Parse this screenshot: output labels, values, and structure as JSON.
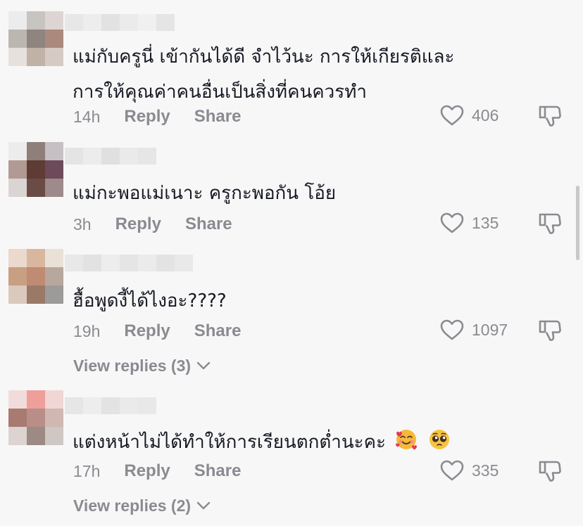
{
  "comments": [
    {
      "text_lines": [
        "แม่กับครูนี่ เข้ากันได้ดี จำไว้นะ การให้เกียรติและ",
        "การให้คุณค่าคนอื่นเป็นสิ่งที่คนควรทำ"
      ],
      "time": "14h",
      "reply_label": "Reply",
      "share_label": "Share",
      "likes": "406",
      "avatar_colors": [
        "#ececec",
        "#c8c4c0",
        "#ddd5d4",
        "#bcb6b1",
        "#8f8480",
        "#aa8a7c",
        "#e6e1dc",
        "#c1b2a8",
        "#d6cbc4"
      ],
      "username_colors": [
        "#e7e7e7",
        "#ededed",
        "#e2e2e2",
        "#ebebeb",
        "#f0f0f0",
        "#e5e5e5"
      ]
    },
    {
      "text_lines": [
        "แม่กะพอแม่เนาะ ครูกะพอกัน โอ้ย"
      ],
      "time": "3h",
      "reply_label": "Reply",
      "share_label": "Share",
      "likes": "135",
      "avatar_colors": [
        "#ececec",
        "#8f7e7a",
        "#c6c0c4",
        "#b29a94",
        "#5e3b33",
        "#6d4a5a",
        "#dad4d2",
        "#6a4c45",
        "#9e8a8b"
      ],
      "username_colors": [
        "#e4e4e4",
        "#ececec",
        "#e0e0e0",
        "#eaeaea",
        "#e6e6e6"
      ]
    },
    {
      "text_lines": [
        "ฮื้อพูดงี้ได้ไงอะ????"
      ],
      "time": "19h",
      "reply_label": "Reply",
      "share_label": "Share",
      "likes": "1097",
      "view_replies": "View replies (3)",
      "avatar_colors": [
        "#ead9cc",
        "#d9b79e",
        "#e9e0d8",
        "#c79f83",
        "#c08b73",
        "#b8a79c",
        "#dcc9bd",
        "#9a7a67",
        "#9d9a9a"
      ],
      "username_colors": [
        "#e8e8e8",
        "#e2e2e2",
        "#ededed",
        "#e5e5e5",
        "#ebebeb",
        "#e3e3e3",
        "#e9e9e9"
      ]
    },
    {
      "text_lines": [
        "แต่งหน้าไม่ได้ทำให้การเรียนตกต่ำนะคะ"
      ],
      "emojis": [
        "smiling-face-with-hearts-emoji",
        "pleading-face-emoji"
      ],
      "time": "17h",
      "reply_label": "Reply",
      "share_label": "Share",
      "likes": "335",
      "view_replies": "View replies (2)",
      "avatar_colors": [
        "#f1dcdc",
        "#ee9f9a",
        "#f0d6d4",
        "#a87a70",
        "#b98d88",
        "#d0b7b2",
        "#ddd3d0",
        "#9d8a84",
        "#cfc7c3"
      ],
      "username_colors": [
        "#e6e6e6",
        "#ededed",
        "#e3e3e3",
        "#eaeaea",
        "#e8e8e8"
      ]
    }
  ],
  "colors": {
    "background": "#f7f7f7",
    "text": "#161823",
    "secondary": "#8a8b91"
  },
  "icons": {
    "like": "heart-outline-icon",
    "dislike": "thumbs-down-icon",
    "expand": "chevron-down-icon"
  }
}
